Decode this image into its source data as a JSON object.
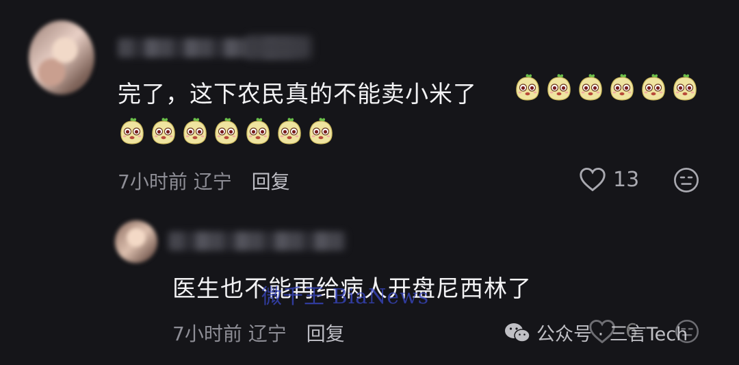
{
  "comments": [
    {
      "text": "完了，这下农民真的不能卖小米了",
      "emoji_count_line1": 6,
      "emoji_count_line2": 7,
      "time": "7小时前",
      "location": "辽宁",
      "reply_label": "回复",
      "likes": "13"
    },
    {
      "text": "医生也不能再给病人开盘尼西林了",
      "time": "7小时前",
      "location": "辽宁",
      "reply_label": "回复",
      "likes": "6"
    }
  ],
  "watermarks": {
    "blue": "微千王 BiaNews",
    "wechat": "公众号 · 三言Tech"
  },
  "emoji_name": "xiaomi-emoji",
  "icons": {
    "like": "heart-outline-icon",
    "dislike": "meh-face-icon",
    "wechat": "wechat-icon"
  }
}
